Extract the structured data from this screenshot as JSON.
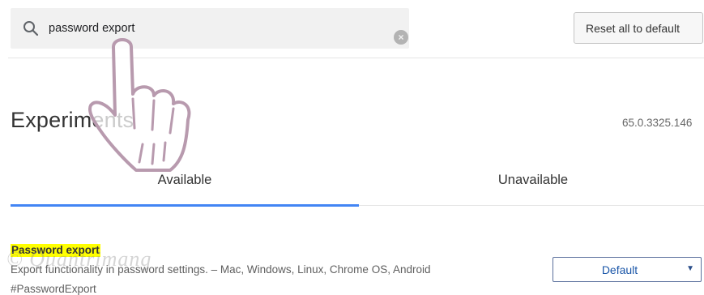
{
  "search": {
    "value": "password export",
    "icon": "search-icon",
    "clear_icon": "close-circle-icon"
  },
  "toolbar": {
    "reset_label": "Reset all to default"
  },
  "header": {
    "title": "Experiments",
    "version": "65.0.3325.146"
  },
  "tabs": [
    {
      "label": "Available",
      "active": true
    },
    {
      "label": "Unavailable",
      "active": false
    }
  ],
  "experiments": [
    {
      "name": "Password export",
      "description": "Export functionality in password settings. – Mac, Windows, Linux, Chrome OS, Android",
      "hash": "#PasswordExport",
      "state": "Default"
    }
  ],
  "colors": {
    "accent": "#4285f4",
    "highlight": "#ffff00",
    "select_text": "#1a56a8"
  },
  "overlays": {
    "hand_pointer": "hand-pointer-icon",
    "watermark": "watermark"
  }
}
